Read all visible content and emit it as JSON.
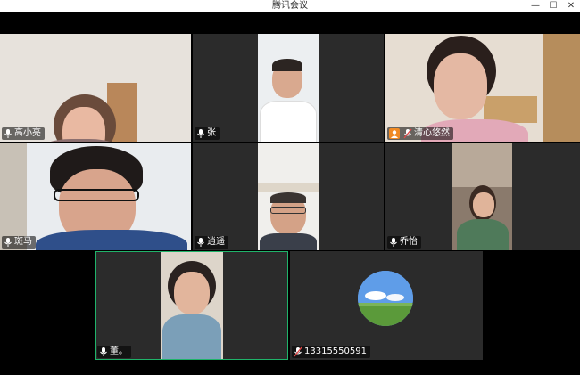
{
  "window": {
    "title": "腾讯会议",
    "minimize_glyph": "—",
    "maximize_glyph": "☐",
    "close_glyph": "✕"
  },
  "participants": [
    {
      "name": "高小亮",
      "mic": "on",
      "bg": "#d8cfc6"
    },
    {
      "name": "张",
      "mic": "on",
      "bg": "#e9ecef"
    },
    {
      "name": "清心悠然",
      "mic": "muted",
      "host": true,
      "bg": "#d9d2ca"
    },
    {
      "name": "斑马",
      "mic": "on",
      "bg": "#e4e8ec"
    },
    {
      "name": "逍遥",
      "mic": "on",
      "bg": "#efefed"
    },
    {
      "name": "乔怡",
      "mic": "on",
      "bg": "#8d7d6f"
    },
    {
      "name": "董。",
      "mic": "on",
      "active": true,
      "bg": "#dcd3c8"
    },
    {
      "name": "13315550591",
      "mic": "muted",
      "bg": "#6fa6e6"
    }
  ],
  "colors": {
    "active_border": "#1fb36a",
    "host_badge": "#f08a24",
    "tile_bg": "#2b2b2b",
    "muted_mic": "#e04848"
  }
}
